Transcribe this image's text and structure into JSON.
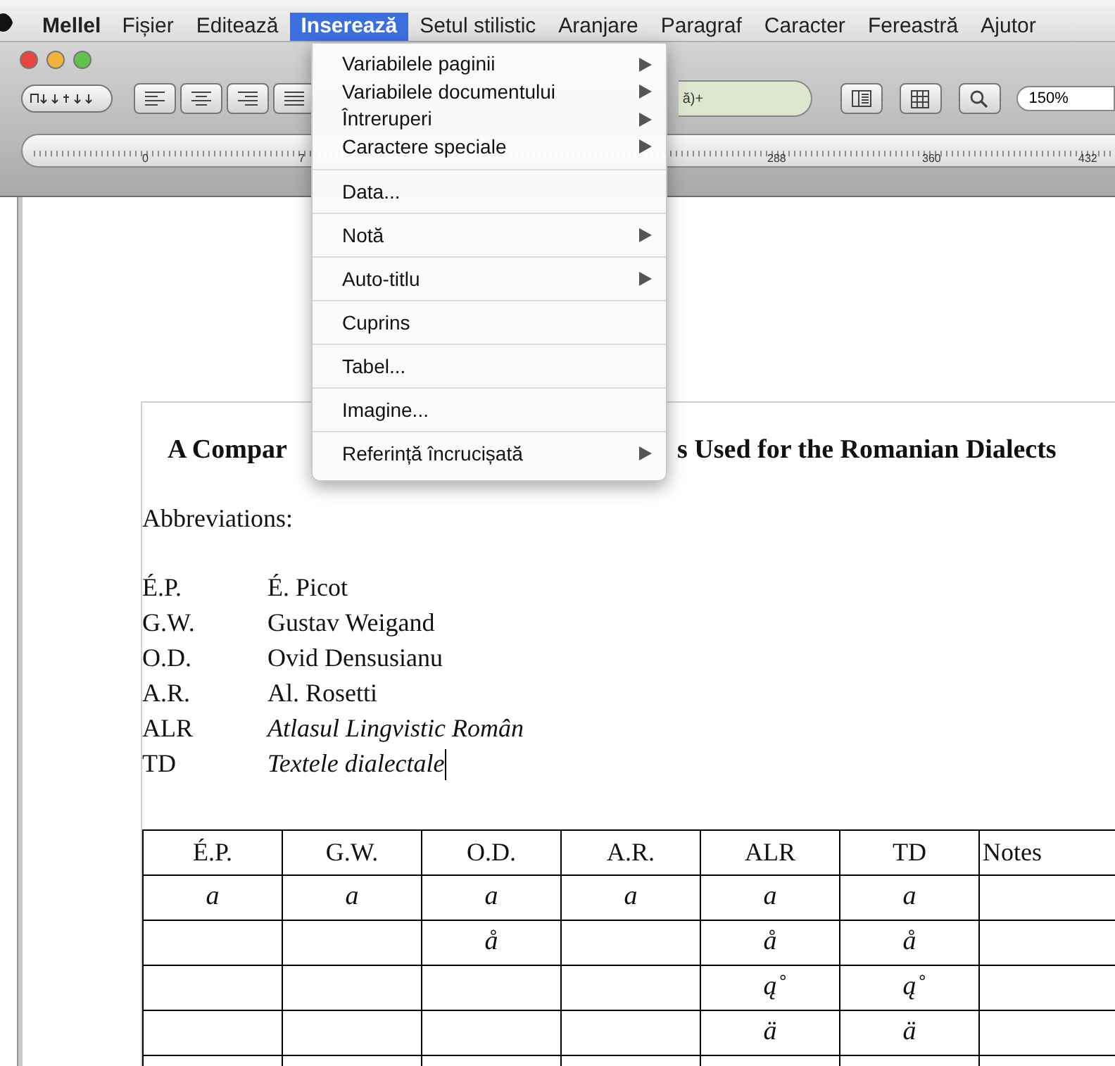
{
  "menubar": {
    "app": "Mellel",
    "items": [
      {
        "label": "Fișier",
        "selected": false
      },
      {
        "label": "Editează",
        "selected": false
      },
      {
        "label": "Inserează",
        "selected": true
      },
      {
        "label": "Setul stilistic",
        "selected": false
      },
      {
        "label": "Aranjare",
        "selected": false
      },
      {
        "label": "Paragraf",
        "selected": false
      },
      {
        "label": "Caracter",
        "selected": false
      },
      {
        "label": "Fereastră",
        "selected": false
      },
      {
        "label": "Ajutor",
        "selected": false
      }
    ]
  },
  "toolbar": {
    "style_field": "ă)+",
    "zoom": "150%"
  },
  "ruler": {
    "labels": [
      "0",
      "7",
      "288",
      "360",
      "432"
    ]
  },
  "menu": {
    "groups": [
      [
        {
          "label": "Variabilele paginii",
          "submenu": true
        },
        {
          "label": "Variabilele documentului",
          "submenu": true
        },
        {
          "label": "Întreruperi",
          "submenu": true
        },
        {
          "label": "Caractere speciale",
          "submenu": true
        }
      ],
      [
        {
          "label": "Data...",
          "submenu": false
        }
      ],
      [
        {
          "label": "Notă",
          "submenu": true
        }
      ],
      [
        {
          "label": "Auto-titlu",
          "submenu": true
        }
      ],
      [
        {
          "label": "Cuprins",
          "submenu": false
        }
      ],
      [
        {
          "label": "Tabel...",
          "submenu": false
        }
      ],
      [
        {
          "label": "Imagine...",
          "submenu": false
        }
      ],
      [
        {
          "label": "Referință încrucișată",
          "submenu": true
        }
      ]
    ]
  },
  "document": {
    "title_left": "A Compar",
    "title_right": "s Used for the Romanian Dialects",
    "abbreviations_heading": "Abbreviations:",
    "abbreviations": [
      {
        "abbr": "É.P.",
        "name": "É. Picot",
        "italic": false
      },
      {
        "abbr": "G.W.",
        "name": "Gustav Weigand",
        "italic": false
      },
      {
        "abbr": "O.D.",
        "name": "Ovid Densusianu",
        "italic": false
      },
      {
        "abbr": "A.R.",
        "name": "Al. Rosetti",
        "italic": false
      },
      {
        "abbr": "ALR",
        "name": "Atlasul Lingvistic Român",
        "italic": true
      },
      {
        "abbr": "TD",
        "name": "Textele dialectale",
        "italic": true
      }
    ],
    "table": {
      "columns": [
        "É.P.",
        "G.W.",
        "O.D.",
        "A.R.",
        "ALR",
        "TD",
        "Notes"
      ],
      "rows": [
        [
          "a",
          "a",
          "a",
          "a",
          "a",
          "a",
          ""
        ],
        [
          "",
          "",
          "å",
          "",
          "å",
          "å",
          ""
        ],
        [
          "",
          "",
          "",
          "",
          "ą̊",
          "ą̊",
          ""
        ],
        [
          "",
          "",
          "",
          "",
          "ä",
          "ä",
          ""
        ],
        [
          "",
          "",
          "",
          "",
          "",
          "",
          ""
        ]
      ]
    }
  }
}
